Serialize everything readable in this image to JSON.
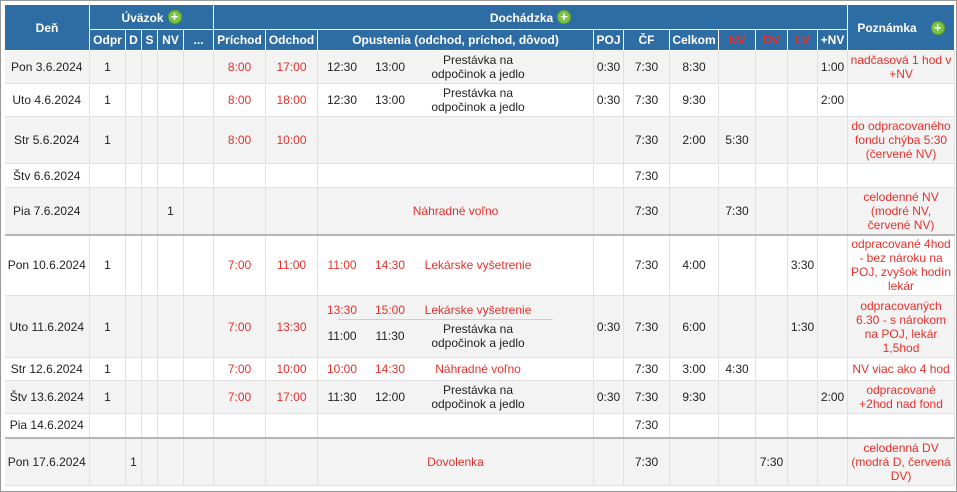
{
  "header": {
    "den": "Deň",
    "uvazok": "Úväzok",
    "dochadzka": "Dochádzka",
    "poznamka": "Poznámka",
    "plus": "+",
    "cols": {
      "odpr": "Odpr",
      "d": "D",
      "s": "S",
      "nv": "NV",
      "more": "...",
      "prichod": "Príchod",
      "odchod": "Odchod",
      "opustenia": "Opustenia (odchod, príchod, dôvod)",
      "poj": "POJ",
      "cf": "ČF",
      "celkom": "Celkom",
      "nv2": "NV",
      "dv": "DV",
      "lv": "LV",
      "plusnv": "+NV"
    }
  },
  "colors": {
    "header_bg": "#2e6da4",
    "plus_green": "#7cc243",
    "red_text": "#e8302b"
  },
  "rows": [
    {
      "den": "Pon 3.6.2024",
      "odpr": "1",
      "d": "",
      "s": "",
      "nv": "",
      "prichod": "8:00",
      "odchod": "17:00",
      "opustenia": [
        {
          "odchod": "12:30",
          "prichod": "13:00",
          "dovod": "Prestávka na odpočinok a jedlo",
          "red": false
        }
      ],
      "poj": "0:30",
      "cf": "7:30",
      "celkom": "8:30",
      "nv2": "",
      "dv": "",
      "lv": "",
      "plusnv": "1:00",
      "poznamka": "nadčasová 1 hod v +NV"
    },
    {
      "den": "Uto 4.6.2024",
      "odpr": "1",
      "d": "",
      "s": "",
      "nv": "",
      "prichod": "8:00",
      "odchod": "18:00",
      "opustenia": [
        {
          "odchod": "12:30",
          "prichod": "13:00",
          "dovod": "Prestávka na odpočinok a jedlo",
          "red": false
        }
      ],
      "poj": "0:30",
      "cf": "7:30",
      "celkom": "9:30",
      "nv2": "",
      "dv": "",
      "lv": "",
      "plusnv": "2:00",
      "poznamka": ""
    },
    {
      "den": "Str 5.6.2024",
      "odpr": "1",
      "d": "",
      "s": "",
      "nv": "",
      "prichod": "8:00",
      "odchod": "10:00",
      "opustenia": [],
      "poj": "",
      "cf": "7:30",
      "celkom": "2:00",
      "nv2": "5:30",
      "dv": "",
      "lv": "",
      "plusnv": "",
      "poznamka": "do odpracovaného fondu chýba 5:30 (červené NV)"
    },
    {
      "den": "Štv 6.6.2024",
      "odpr": "",
      "d": "",
      "s": "",
      "nv": "",
      "prichod": "",
      "odchod": "",
      "opustenia": [],
      "poj": "",
      "cf": "7:30",
      "celkom": "",
      "nv2": "",
      "dv": "",
      "lv": "",
      "plusnv": "",
      "poznamka": ""
    },
    {
      "den": "Pia 7.6.2024",
      "odpr": "",
      "d": "",
      "s": "",
      "nv": "1",
      "prichod": "",
      "odchod": "",
      "opustenia": [
        {
          "odchod": "",
          "prichod": "",
          "dovod": "Náhradné voľno",
          "red": true
        }
      ],
      "poj": "",
      "cf": "7:30",
      "celkom": "",
      "nv2": "7:30",
      "dv": "",
      "lv": "",
      "plusnv": "",
      "poznamka": "celodenné NV (modré NV, červené NV)"
    },
    {
      "den": "Pon 10.6.2024",
      "odpr": "1",
      "d": "",
      "s": "",
      "nv": "",
      "prichod": "7:00",
      "odchod": "11:00",
      "opustenia": [
        {
          "odchod": "11:00",
          "prichod": "14:30",
          "dovod": "Lekárske vyšetrenie",
          "red": true
        }
      ],
      "poj": "",
      "cf": "7:30",
      "celkom": "4:00",
      "nv2": "",
      "dv": "",
      "lv": "3:30",
      "plusnv": "",
      "poznamka": "odpracované 4hod - bez nároku na POJ, zvyšok hodín lekár"
    },
    {
      "den": "Uto 11.6.2024",
      "odpr": "1",
      "d": "",
      "s": "",
      "nv": "",
      "prichod": "7:00",
      "odchod": "13:30",
      "opustenia": [
        {
          "odchod": "13:30",
          "prichod": "15:00",
          "dovod": "Lekárske vyšetrenie",
          "red": true
        },
        {
          "odchod": "11:00",
          "prichod": "11:30",
          "dovod": "Prestávka na odpočinok a jedlo",
          "red": false
        }
      ],
      "poj": "0:30",
      "cf": "7:30",
      "celkom": "6:00",
      "nv2": "",
      "dv": "",
      "lv": "1:30",
      "plusnv": "",
      "poznamka": "odpracovaných 6.30 - s nárokom na POJ, lekár 1,5hod"
    },
    {
      "den": "Str 12.6.2024",
      "odpr": "1",
      "d": "",
      "s": "",
      "nv": "",
      "prichod": "7:00",
      "odchod": "10:00",
      "opustenia": [
        {
          "odchod": "10:00",
          "prichod": "14:30",
          "dovod": "Náhradné voľno",
          "red": true
        }
      ],
      "poj": "",
      "cf": "7:30",
      "celkom": "3:00",
      "nv2": "4:30",
      "dv": "",
      "lv": "",
      "plusnv": "",
      "poznamka": "NV viac ako 4 hod"
    },
    {
      "den": "Štv 13.6.2024",
      "odpr": "1",
      "d": "",
      "s": "",
      "nv": "",
      "prichod": "7:00",
      "odchod": "17:00",
      "opustenia": [
        {
          "odchod": "11:30",
          "prichod": "12:00",
          "dovod": "Prestávka na odpočinok a jedlo",
          "red": false
        }
      ],
      "poj": "0:30",
      "cf": "7:30",
      "celkom": "9:30",
      "nv2": "",
      "dv": "",
      "lv": "",
      "plusnv": "2:00",
      "poznamka": "odpracované +2hod nad fond"
    },
    {
      "den": "Pia 14.6.2024",
      "odpr": "",
      "d": "",
      "s": "",
      "nv": "",
      "prichod": "",
      "odchod": "",
      "opustenia": [],
      "poj": "",
      "cf": "7:30",
      "celkom": "",
      "nv2": "",
      "dv": "",
      "lv": "",
      "plusnv": "",
      "poznamka": ""
    },
    {
      "den": "Pon 17.6.2024",
      "odpr": "",
      "d": "1",
      "s": "",
      "nv": "",
      "prichod": "",
      "odchod": "",
      "opustenia": [
        {
          "odchod": "",
          "prichod": "",
          "dovod": "Dovolenka",
          "red": true
        }
      ],
      "poj": "",
      "cf": "7:30",
      "celkom": "",
      "nv2": "",
      "dv": "7:30",
      "lv": "",
      "plusnv": "",
      "poznamka": "celodenná DV (modrá D, červená DV)"
    }
  ]
}
